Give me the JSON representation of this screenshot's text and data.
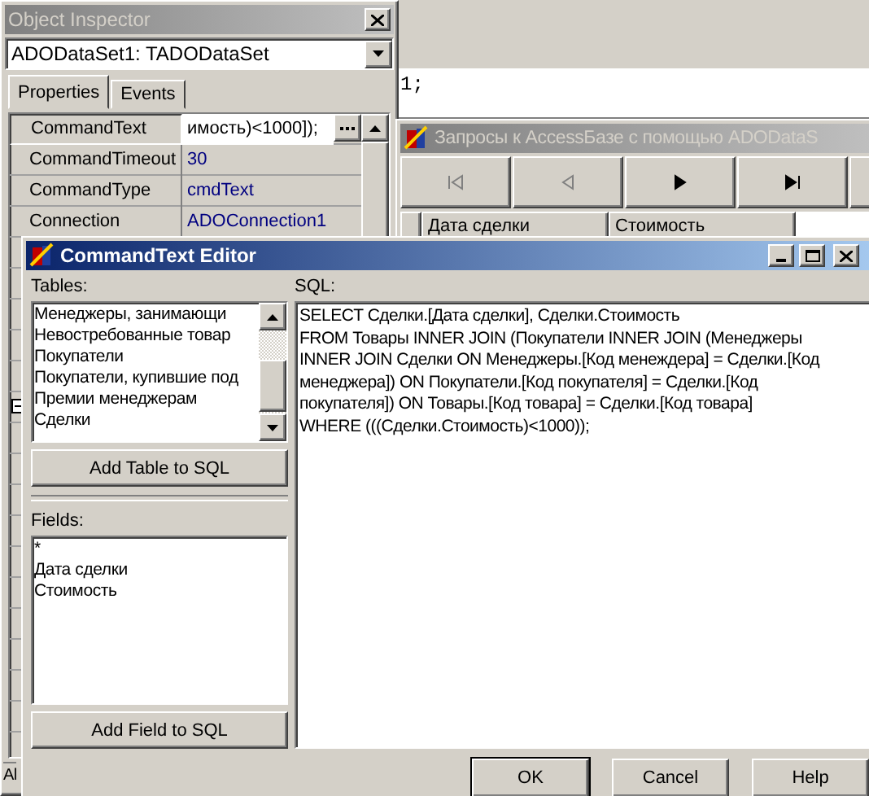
{
  "object_inspector": {
    "title": "Object Inspector",
    "component": "ADODataSet1: TADODataSet",
    "tabs": [
      {
        "label": "Properties",
        "selected": true
      },
      {
        "label": "Events",
        "selected": false
      }
    ],
    "properties": [
      {
        "name": "CommandText",
        "value": "имость)<1000]);",
        "selected": true
      },
      {
        "name": "CommandTimeout",
        "value": "30",
        "selected": false
      },
      {
        "name": "CommandType",
        "value": "cmdText",
        "selected": false
      },
      {
        "name": "Connection",
        "value": "ADOConnection1",
        "selected": false
      }
    ],
    "status": "Al"
  },
  "code_editor": {
    "line": "1;"
  },
  "form": {
    "title": "Запросы к AccessБазе с помощью ADODataS",
    "navigator": [
      {
        "kind": "first",
        "disabled": true
      },
      {
        "kind": "prior",
        "disabled": true
      },
      {
        "kind": "next",
        "disabled": false
      },
      {
        "kind": "last",
        "disabled": false
      }
    ],
    "grid_columns": [
      "Дата сделки",
      "Стоимость"
    ]
  },
  "dialog": {
    "title": "CommandText Editor",
    "tables_label": "Tables:",
    "tables": [
      {
        "label": "Менеджеры, занимающи",
        "selected": false
      },
      {
        "label": "Невостребованные товар",
        "selected": false
      },
      {
        "label": "Покупатели",
        "selected": false
      },
      {
        "label": "Покупатели, купившие под",
        "selected": false
      },
      {
        "label": "Премии менеджерам",
        "selected": false
      },
      {
        "label": "Сделки",
        "selected": false
      }
    ],
    "add_table_button": "Add Table to SQL",
    "fields_label": "Fields:",
    "fields": [
      {
        "label": "*",
        "selected": false
      },
      {
        "label": "Дата сделки",
        "selected": false
      },
      {
        "label": "Стоимость",
        "selected": false
      }
    ],
    "add_field_button": "Add Field to SQL",
    "sql_label": "SQL:",
    "sql": "SELECT Сделки.[Дата сделки], Сделки.Стоимость\nFROM Товары INNER JOIN (Покупатели INNER JOIN (Менеджеры\nINNER JOIN Сделки ON Менеджеры.[Код менеждера] = Сделки.[Код\nменеджера]) ON Покупатели.[Код покупателя] = Сделки.[Код\nпокупателя]) ON Товары.[Код товара] = Сделки.[Код товара]\nWHERE (((Сделки.Стоимость)<1000));",
    "buttons": [
      {
        "label": "OK",
        "default": true
      },
      {
        "label": "Cancel",
        "default": false
      },
      {
        "label": "Help",
        "default": false
      }
    ]
  }
}
